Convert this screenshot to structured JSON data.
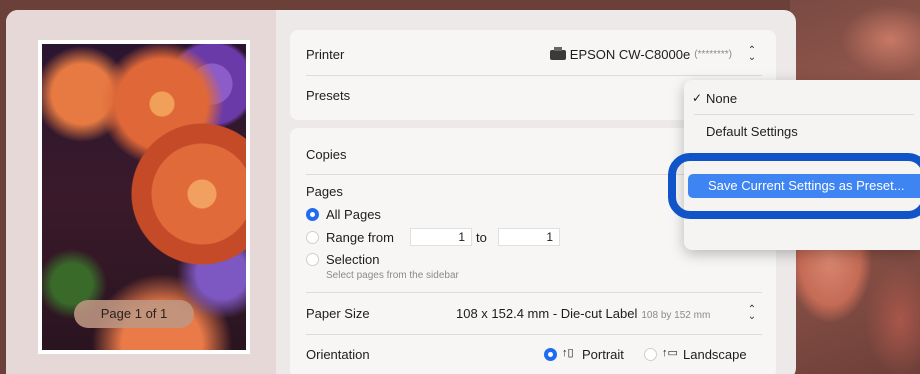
{
  "preview": {
    "page_indicator": "Page 1 of 1"
  },
  "printer": {
    "label": "Printer",
    "value": "EPSON CW-C8000e",
    "masked": "(********)",
    "icon": "printer-icon"
  },
  "presets": {
    "label": "Presets"
  },
  "copies": {
    "label": "Copies"
  },
  "pages": {
    "label": "Pages",
    "all_pages": "All Pages",
    "range_from": "Range from",
    "range_from_value": "1",
    "range_to": "to",
    "range_to_value": "1",
    "selection": "Selection",
    "selection_hint": "Select pages from the sidebar"
  },
  "paper_size": {
    "label": "Paper Size",
    "value": "108 x 152.4 mm - Die-cut Label",
    "detail": "108 by 152 mm"
  },
  "orientation": {
    "label": "Orientation",
    "portrait": "Portrait",
    "landscape": "Landscape",
    "selected": "Portrait"
  },
  "presets_menu": {
    "items": [
      {
        "label": "None",
        "checked": true
      },
      {
        "label": "Default Settings"
      },
      {
        "label": "Save Current Settings as Preset..."
      }
    ]
  },
  "colors": {
    "accent": "#1f6bf2",
    "menu_highlight": "#3e84f2",
    "callout_ring": "#1054c8"
  }
}
